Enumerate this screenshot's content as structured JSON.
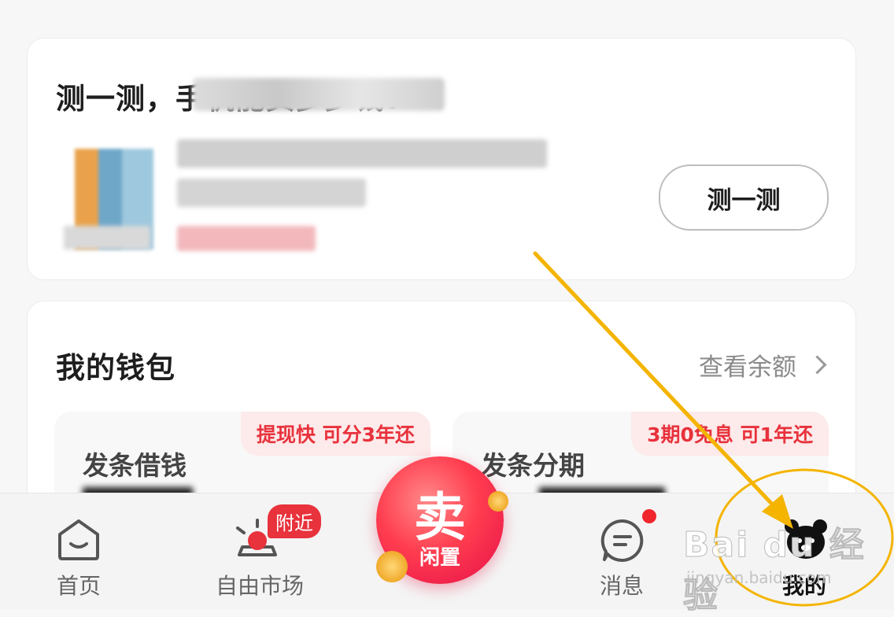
{
  "test_card": {
    "title": "测一测，手机能卖多少钱?",
    "button_label": "测一测"
  },
  "wallet": {
    "title": "我的钱包",
    "balance_link": "查看余额",
    "tiles": [
      {
        "label": "发条借钱",
        "badge": "提现快 可分3年还"
      },
      {
        "label": "发条分期",
        "badge": "3期0免息 可1年还"
      }
    ]
  },
  "tab_bar": {
    "home": "首页",
    "market": "自由市场",
    "nearby_badge": "附近",
    "sell_main": "卖",
    "sell_sub": "闲置",
    "messages": "消息",
    "mine": "我的"
  },
  "watermark": {
    "logo": "Bai du 经验",
    "url": "jingyan.baidu.com"
  },
  "colors": {
    "accent_red": "#e8323c",
    "annotation_yellow": "#f4b400"
  }
}
